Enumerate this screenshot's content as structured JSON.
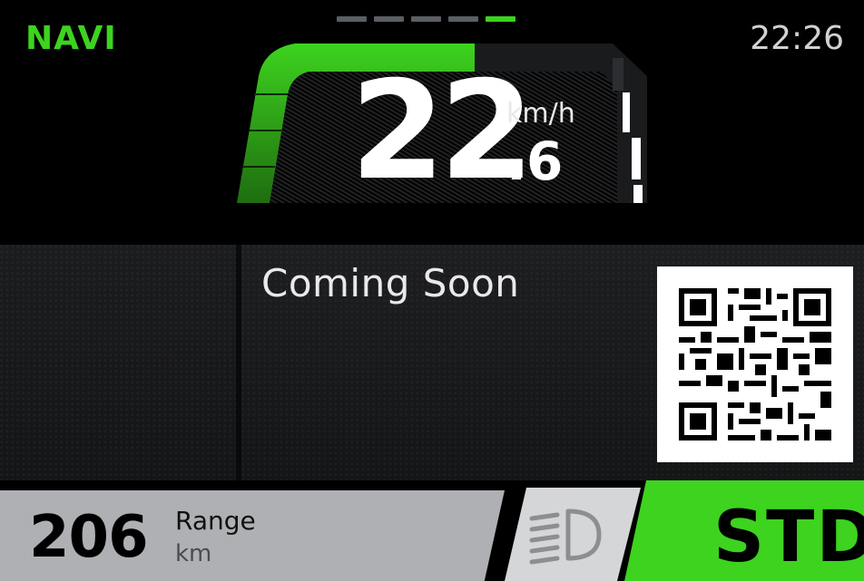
{
  "mode_label": "NAVI",
  "clock": "22:26",
  "speed": {
    "integer": "22",
    "decimal": ".6",
    "unit": "km/h"
  },
  "page_indicator": {
    "count": 5,
    "active_index": 4
  },
  "panel": {
    "message": "Coming Soon"
  },
  "range": {
    "value": "206",
    "label": "Range",
    "unit": "km"
  },
  "ride_mode": "STD",
  "headlight_icon": "low-beam-headlight-icon",
  "colors": {
    "accent_green": "#3dd31f",
    "light_grey": "#aeb0b3",
    "inactive_dot": "#5b5e62"
  }
}
